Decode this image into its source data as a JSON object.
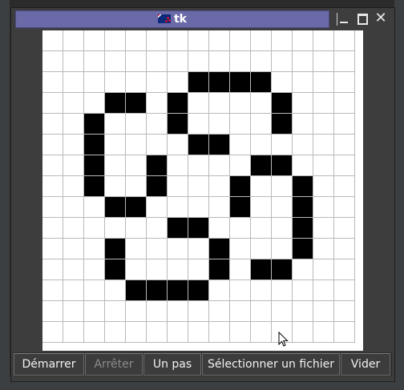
{
  "window": {
    "title": "tk"
  },
  "toolbar": {
    "start_label": "Démarrer",
    "stop_label": "Arrêter",
    "step_label": "Un pas",
    "select_file_label": "Sélectionner un fichier",
    "clear_label": "Vider"
  },
  "grid": {
    "rows": 15,
    "cols": 15,
    "alive_cells": [
      [
        2,
        7
      ],
      [
        2,
        8
      ],
      [
        2,
        9
      ],
      [
        2,
        10
      ],
      [
        3,
        3
      ],
      [
        3,
        4
      ],
      [
        3,
        6
      ],
      [
        3,
        11
      ],
      [
        4,
        2
      ],
      [
        4,
        6
      ],
      [
        4,
        11
      ],
      [
        5,
        2
      ],
      [
        5,
        7
      ],
      [
        5,
        8
      ],
      [
        6,
        2
      ],
      [
        6,
        5
      ],
      [
        6,
        10
      ],
      [
        6,
        11
      ],
      [
        7,
        2
      ],
      [
        7,
        5
      ],
      [
        7,
        9
      ],
      [
        7,
        12
      ],
      [
        8,
        3
      ],
      [
        8,
        4
      ],
      [
        8,
        9
      ],
      [
        8,
        12
      ],
      [
        9,
        6
      ],
      [
        9,
        7
      ],
      [
        9,
        12
      ],
      [
        10,
        3
      ],
      [
        10,
        8
      ],
      [
        10,
        12
      ],
      [
        11,
        3
      ],
      [
        11,
        8
      ],
      [
        11,
        10
      ],
      [
        11,
        11
      ],
      [
        12,
        4
      ],
      [
        12,
        5
      ],
      [
        12,
        6
      ],
      [
        12,
        7
      ]
    ]
  },
  "colors": {
    "titlebar": "#6b6aa8",
    "alive": "#000000",
    "dead": "#ffffff"
  }
}
